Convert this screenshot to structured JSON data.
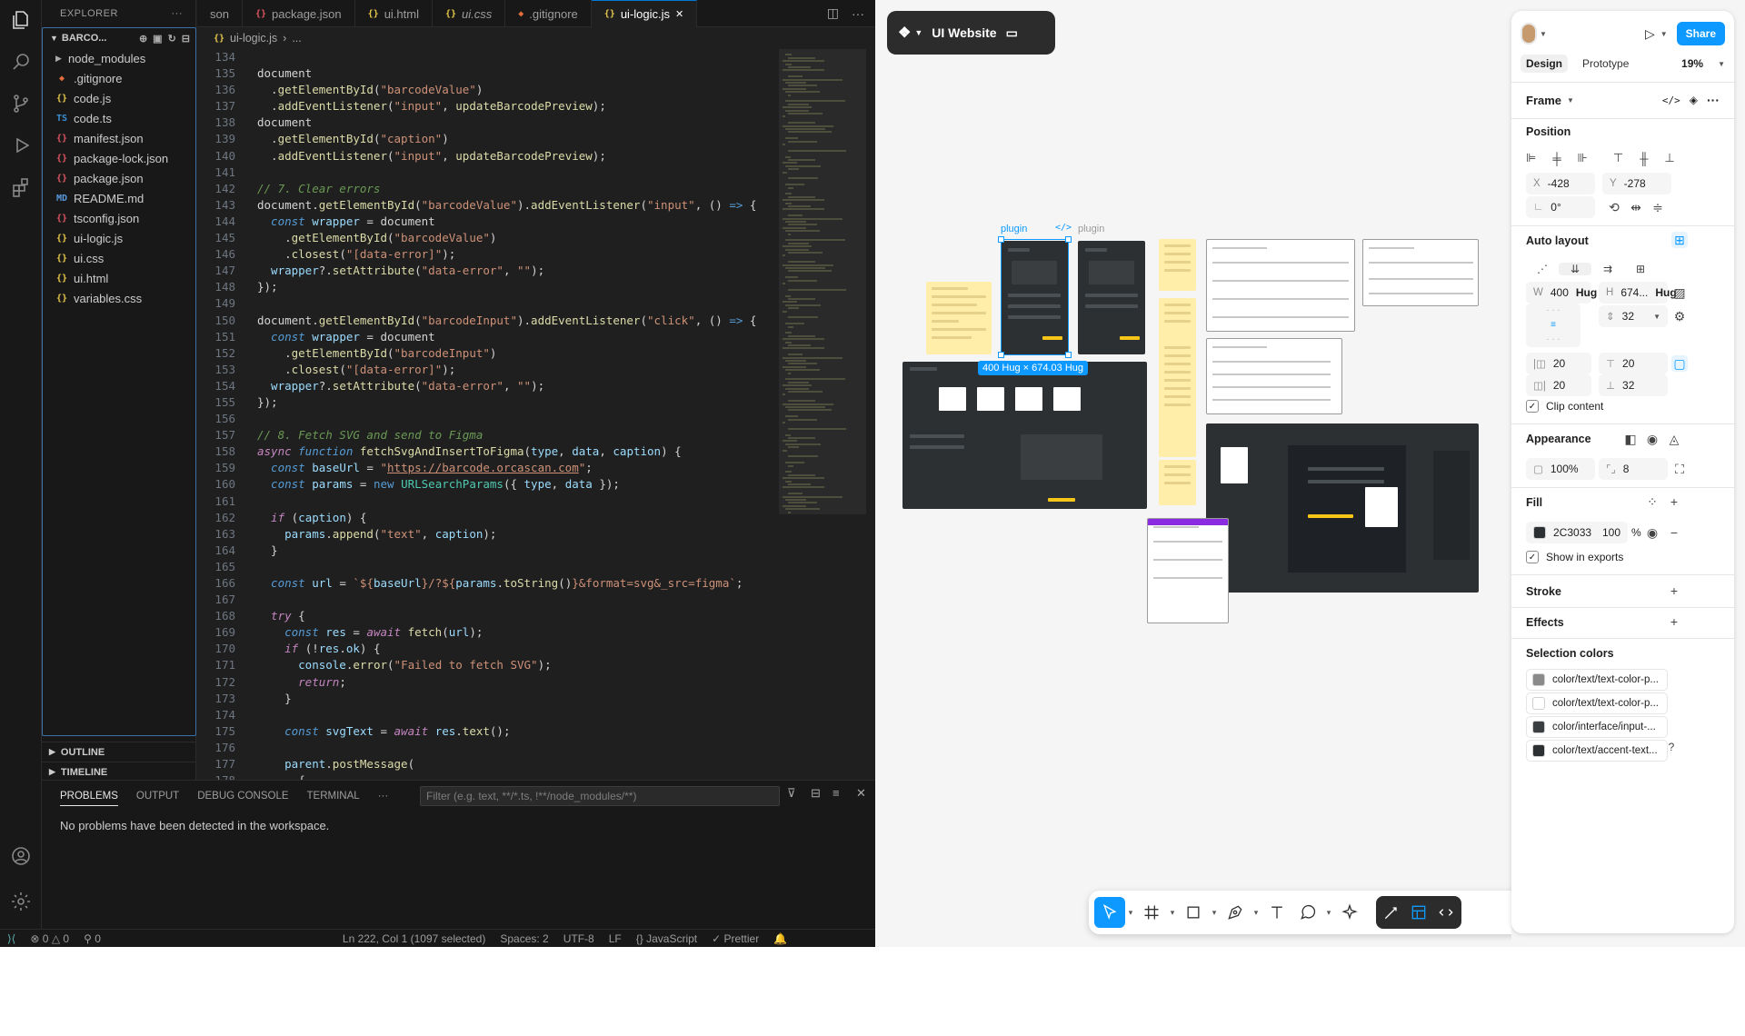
{
  "vscode": {
    "explorer_title": "EXPLORER",
    "root_folder": "BARCO...",
    "files": [
      {
        "name": "node_modules",
        "type": "folder"
      },
      {
        "name": ".gitignore",
        "type": "git"
      },
      {
        "name": "code.js",
        "type": "js"
      },
      {
        "name": "code.ts",
        "type": "ts"
      },
      {
        "name": "manifest.json",
        "type": "json"
      },
      {
        "name": "package-lock.json",
        "type": "json"
      },
      {
        "name": "package.json",
        "type": "json"
      },
      {
        "name": "README.md",
        "type": "md"
      },
      {
        "name": "tsconfig.json",
        "type": "json"
      },
      {
        "name": "ui-logic.js",
        "type": "js"
      },
      {
        "name": "ui.css",
        "type": "css"
      },
      {
        "name": "ui.html",
        "type": "html"
      },
      {
        "name": "variables.css",
        "type": "css"
      }
    ],
    "outline_label": "OUTLINE",
    "timeline_label": "TIMELINE",
    "tabs": [
      {
        "label": "son",
        "icon": "",
        "active": false,
        "italic": false
      },
      {
        "label": "package.json",
        "icon": "json",
        "active": false,
        "italic": false
      },
      {
        "label": "ui.html",
        "icon": "html",
        "active": false,
        "italic": false
      },
      {
        "label": "ui.css",
        "icon": "css",
        "active": false,
        "italic": true
      },
      {
        "label": ".gitignore",
        "icon": "git",
        "active": false,
        "italic": false
      },
      {
        "label": "ui-logic.js",
        "icon": "js",
        "active": true,
        "italic": false
      }
    ],
    "breadcrumb": [
      "ui-logic.js",
      "..."
    ],
    "panel": {
      "tabs": [
        "PROBLEMS",
        "OUTPUT",
        "DEBUG CONSOLE",
        "TERMINAL"
      ],
      "filter_placeholder": "Filter (e.g. text, **/*.ts, !**/node_modules/**)",
      "message": "No problems have been detected in the workspace."
    },
    "statusbar": {
      "errors": "0",
      "warnings": "0",
      "ports": "0",
      "position": "Ln 222, Col 1 (1097 selected)",
      "spaces": "Spaces: 2",
      "encoding": "UTF-8",
      "eol": "LF",
      "language": "JavaScript",
      "formatter": "Prettier"
    }
  },
  "code_lines": [
    {
      "n": "134",
      "t": [
        [
          "p",
          ""
        ]
      ]
    },
    {
      "n": "135",
      "t": [
        [
          "p",
          "document"
        ]
      ]
    },
    {
      "n": "136",
      "t": [
        [
          "p",
          "  ."
        ],
        [
          "f",
          "getElementById"
        ],
        [
          "p",
          "("
        ],
        [
          "s",
          "\"barcodeValue\""
        ],
        [
          "p",
          ")"
        ]
      ]
    },
    {
      "n": "137",
      "t": [
        [
          "p",
          "  ."
        ],
        [
          "f",
          "addEventListener"
        ],
        [
          "p",
          "("
        ],
        [
          "s",
          "\"input\""
        ],
        [
          "p",
          ", "
        ],
        [
          "f",
          "updateBarcodePreview"
        ],
        [
          "p",
          ");"
        ]
      ]
    },
    {
      "n": "138",
      "t": [
        [
          "p",
          "document"
        ]
      ]
    },
    {
      "n": "139",
      "t": [
        [
          "p",
          "  ."
        ],
        [
          "f",
          "getElementById"
        ],
        [
          "p",
          "("
        ],
        [
          "s",
          "\"caption\""
        ],
        [
          "p",
          ")"
        ]
      ]
    },
    {
      "n": "140",
      "t": [
        [
          "p",
          "  ."
        ],
        [
          "f",
          "addEventListener"
        ],
        [
          "p",
          "("
        ],
        [
          "s",
          "\"input\""
        ],
        [
          "p",
          ", "
        ],
        [
          "f",
          "updateBarcodePreview"
        ],
        [
          "p",
          ");"
        ]
      ]
    },
    {
      "n": "141",
      "t": [
        [
          "p",
          ""
        ]
      ]
    },
    {
      "n": "142",
      "t": [
        [
          "c",
          "// 7. Clear errors"
        ]
      ]
    },
    {
      "n": "143",
      "t": [
        [
          "p",
          "document."
        ],
        [
          "f",
          "getElementById"
        ],
        [
          "p",
          "("
        ],
        [
          "s",
          "\"barcodeValue\""
        ],
        [
          "p",
          ")."
        ],
        [
          "f",
          "addEventListener"
        ],
        [
          "p",
          "("
        ],
        [
          "s",
          "\"input\""
        ],
        [
          "p",
          ", () "
        ],
        [
          "k",
          "=>"
        ],
        [
          "p",
          " {"
        ]
      ]
    },
    {
      "n": "144",
      "t": [
        [
          "it",
          "  const "
        ],
        [
          "v",
          "wrapper"
        ],
        [
          "p",
          " = document"
        ]
      ]
    },
    {
      "n": "145",
      "t": [
        [
          "p",
          "    ."
        ],
        [
          "f",
          "getElementById"
        ],
        [
          "p",
          "("
        ],
        [
          "s",
          "\"barcodeValue\""
        ],
        [
          "p",
          ")"
        ]
      ]
    },
    {
      "n": "146",
      "t": [
        [
          "p",
          "    ."
        ],
        [
          "f",
          "closest"
        ],
        [
          "p",
          "("
        ],
        [
          "s",
          "\"[data-error]\""
        ],
        [
          "p",
          ");"
        ]
      ]
    },
    {
      "n": "147",
      "t": [
        [
          "v",
          "  wrapper"
        ],
        [
          "p",
          "?."
        ],
        [
          "f",
          "setAttribute"
        ],
        [
          "p",
          "("
        ],
        [
          "s",
          "\"data-error\""
        ],
        [
          "p",
          ", "
        ],
        [
          "s",
          "\"\""
        ],
        [
          "p",
          ");"
        ]
      ]
    },
    {
      "n": "148",
      "t": [
        [
          "p",
          "});"
        ]
      ]
    },
    {
      "n": "149",
      "t": [
        [
          "p",
          ""
        ]
      ]
    },
    {
      "n": "150",
      "t": [
        [
          "p",
          "document."
        ],
        [
          "f",
          "getElementById"
        ],
        [
          "p",
          "("
        ],
        [
          "s",
          "\"barcodeInput\""
        ],
        [
          "p",
          ")."
        ],
        [
          "f",
          "addEventListener"
        ],
        [
          "p",
          "("
        ],
        [
          "s",
          "\"click\""
        ],
        [
          "p",
          ", () "
        ],
        [
          "k",
          "=>"
        ],
        [
          "p",
          " {"
        ]
      ]
    },
    {
      "n": "151",
      "t": [
        [
          "it",
          "  const "
        ],
        [
          "v",
          "wrapper"
        ],
        [
          "p",
          " = document"
        ]
      ]
    },
    {
      "n": "152",
      "t": [
        [
          "p",
          "    ."
        ],
        [
          "f",
          "getElementById"
        ],
        [
          "p",
          "("
        ],
        [
          "s",
          "\"barcodeInput\""
        ],
        [
          "p",
          ")"
        ]
      ]
    },
    {
      "n": "153",
      "t": [
        [
          "p",
          "    ."
        ],
        [
          "f",
          "closest"
        ],
        [
          "p",
          "("
        ],
        [
          "s",
          "\"[data-error]\""
        ],
        [
          "p",
          ");"
        ]
      ]
    },
    {
      "n": "154",
      "t": [
        [
          "v",
          "  wrapper"
        ],
        [
          "p",
          "?."
        ],
        [
          "f",
          "setAttribute"
        ],
        [
          "p",
          "("
        ],
        [
          "s",
          "\"data-error\""
        ],
        [
          "p",
          ", "
        ],
        [
          "s",
          "\"\""
        ],
        [
          "p",
          ");"
        ]
      ]
    },
    {
      "n": "155",
      "t": [
        [
          "p",
          "});"
        ]
      ]
    },
    {
      "n": "156",
      "t": [
        [
          "p",
          ""
        ]
      ]
    },
    {
      "n": "157",
      "t": [
        [
          "c",
          "// 8. Fetch SVG and send to Figma"
        ]
      ]
    },
    {
      "n": "158",
      "t": [
        [
          "kf",
          "async "
        ],
        [
          "it",
          "function "
        ],
        [
          "f",
          "fetchSvgAndInsertToFigma"
        ],
        [
          "p",
          "("
        ],
        [
          "v",
          "type"
        ],
        [
          "p",
          ", "
        ],
        [
          "v",
          "data"
        ],
        [
          "p",
          ", "
        ],
        [
          "v",
          "caption"
        ],
        [
          "p",
          ") {"
        ]
      ]
    },
    {
      "n": "159",
      "t": [
        [
          "it",
          "  const "
        ],
        [
          "v",
          "baseUrl"
        ],
        [
          "p",
          " = "
        ],
        [
          "s",
          "\""
        ],
        [
          "u",
          "https://barcode.orcascan.com"
        ],
        [
          "s",
          "\""
        ],
        [
          "p",
          ";"
        ]
      ]
    },
    {
      "n": "160",
      "t": [
        [
          "it",
          "  const "
        ],
        [
          "v",
          "params"
        ],
        [
          "p",
          " = "
        ],
        [
          "k",
          "new "
        ],
        [
          "ty",
          "URLSearchParams"
        ],
        [
          "p",
          "({ "
        ],
        [
          "v",
          "type"
        ],
        [
          "p",
          ", "
        ],
        [
          "v",
          "data"
        ],
        [
          "p",
          " });"
        ]
      ]
    },
    {
      "n": "161",
      "t": [
        [
          "p",
          ""
        ]
      ]
    },
    {
      "n": "162",
      "t": [
        [
          "kf",
          "  if "
        ],
        [
          "p",
          "("
        ],
        [
          "v",
          "caption"
        ],
        [
          "p",
          ") {"
        ]
      ]
    },
    {
      "n": "163",
      "t": [
        [
          "v",
          "    params"
        ],
        [
          "p",
          "."
        ],
        [
          "f",
          "append"
        ],
        [
          "p",
          "("
        ],
        [
          "s",
          "\"text\""
        ],
        [
          "p",
          ", "
        ],
        [
          "v",
          "caption"
        ],
        [
          "p",
          ");"
        ]
      ]
    },
    {
      "n": "164",
      "t": [
        [
          "p",
          "  }"
        ]
      ]
    },
    {
      "n": "165",
      "t": [
        [
          "p",
          ""
        ]
      ]
    },
    {
      "n": "166",
      "t": [
        [
          "it",
          "  const "
        ],
        [
          "v",
          "url"
        ],
        [
          "p",
          " = "
        ],
        [
          "s",
          "`${"
        ],
        [
          "v",
          "baseUrl"
        ],
        [
          "s",
          "}/?${"
        ],
        [
          "v",
          "params"
        ],
        [
          "p",
          "."
        ],
        [
          "f",
          "toString"
        ],
        [
          "p",
          "()"
        ],
        [
          "s",
          "}&format=svg&_src=figma`"
        ],
        [
          "p",
          ";"
        ]
      ]
    },
    {
      "n": "167",
      "t": [
        [
          "p",
          ""
        ]
      ]
    },
    {
      "n": "168",
      "t": [
        [
          "kf",
          "  try "
        ],
        [
          "p",
          "{"
        ]
      ]
    },
    {
      "n": "169",
      "t": [
        [
          "it",
          "    const "
        ],
        [
          "v",
          "res"
        ],
        [
          "p",
          " = "
        ],
        [
          "kf",
          "await "
        ],
        [
          "f",
          "fetch"
        ],
        [
          "p",
          "("
        ],
        [
          "v",
          "url"
        ],
        [
          "p",
          ");"
        ]
      ]
    },
    {
      "n": "170",
      "t": [
        [
          "kf",
          "    if "
        ],
        [
          "p",
          "(!"
        ],
        [
          "v",
          "res"
        ],
        [
          "p",
          "."
        ],
        [
          "v",
          "ok"
        ],
        [
          "p",
          ") {"
        ]
      ]
    },
    {
      "n": "171",
      "t": [
        [
          "v",
          "      console"
        ],
        [
          "p",
          "."
        ],
        [
          "f",
          "error"
        ],
        [
          "p",
          "("
        ],
        [
          "s",
          "\"Failed to fetch SVG\""
        ],
        [
          "p",
          ");"
        ]
      ]
    },
    {
      "n": "172",
      "t": [
        [
          "kf",
          "      return"
        ],
        [
          "p",
          ";"
        ]
      ]
    },
    {
      "n": "173",
      "t": [
        [
          "p",
          "    }"
        ]
      ]
    },
    {
      "n": "174",
      "t": [
        [
          "p",
          ""
        ]
      ]
    },
    {
      "n": "175",
      "t": [
        [
          "it",
          "    const "
        ],
        [
          "v",
          "svgText"
        ],
        [
          "p",
          " = "
        ],
        [
          "kf",
          "await "
        ],
        [
          "v",
          "res"
        ],
        [
          "p",
          "."
        ],
        [
          "f",
          "text"
        ],
        [
          "p",
          "();"
        ]
      ]
    },
    {
      "n": "176",
      "t": [
        [
          "p",
          ""
        ]
      ]
    },
    {
      "n": "177",
      "t": [
        [
          "v",
          "    parent"
        ],
        [
          "p",
          "."
        ],
        [
          "f",
          "postMessage"
        ],
        [
          "p",
          "("
        ]
      ]
    },
    {
      "n": "178",
      "t": [
        [
          "p",
          "      {"
        ]
      ]
    }
  ],
  "figma": {
    "file_title": "UI Website",
    "frame_labels": [
      "plugin",
      "plugin"
    ],
    "size_badge": "400 Hug × 674.03 Hug",
    "share_label": "Share",
    "design_tab": "Design",
    "prototype_tab": "Prototype",
    "zoom": "19%",
    "frame_type": "Frame",
    "position": {
      "title": "Position",
      "x": "-428",
      "y": "-278",
      "rotation": "0°"
    },
    "auto_layout": {
      "title": "Auto layout",
      "w": "400",
      "w_mode": "Hug",
      "h": "674...",
      "h_mode": "Hug",
      "gap": "32",
      "pad_left": "20",
      "pad_top": "20",
      "pad_right": "20",
      "pad_bottom": "32",
      "clip_label": "Clip content"
    },
    "appearance": {
      "title": "Appearance",
      "opacity": "100%",
      "radius": "8"
    },
    "fill": {
      "title": "Fill",
      "hex": "2C3033",
      "opacity": "100",
      "unit": "%",
      "export_label": "Show in exports"
    },
    "stroke_title": "Stroke",
    "effects_title": "Effects",
    "selection_colors": {
      "title": "Selection colors",
      "items": [
        {
          "label": "color/text/text-color-p...",
          "color": "#8a8a8a"
        },
        {
          "label": "color/text/text-color-p...",
          "color": "#ffffff"
        },
        {
          "label": "color/interface/input-...",
          "color": "#3a3e41"
        },
        {
          "label": "color/text/accent-text...",
          "color": "#2c3033"
        }
      ]
    },
    "help": "?"
  }
}
